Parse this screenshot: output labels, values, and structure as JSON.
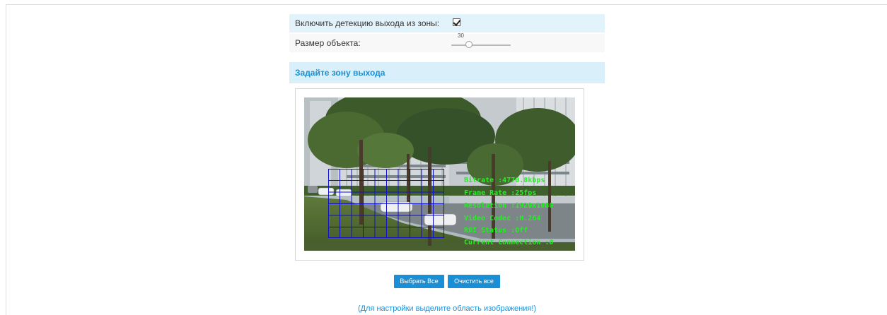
{
  "settings": {
    "enable_label": "Включить детекцию выхода из зоны:",
    "enable_checked": true,
    "size_label": "Размер объекта:",
    "size_value": "30",
    "size_level": 0.3
  },
  "zone": {
    "title": "Задайте зону выхода",
    "osd": [
      "Bitrate :4770.8kbps",
      "Frame Rate :25fps",
      "Resolution :1920x1080",
      "Video Codec :H.264",
      "ROI Status :Off",
      "Current Connection :0"
    ]
  },
  "buttons": {
    "select_all": "Выбрать Все",
    "clear_all": "Очистить все"
  },
  "hint": "(Для настройки выделите область изображения!)",
  "colors": {
    "accent": "#1a8fd6",
    "row_highlight": "#e3f3fb",
    "grid_line": "#1010c8",
    "osd_text": "#1cf51c"
  }
}
